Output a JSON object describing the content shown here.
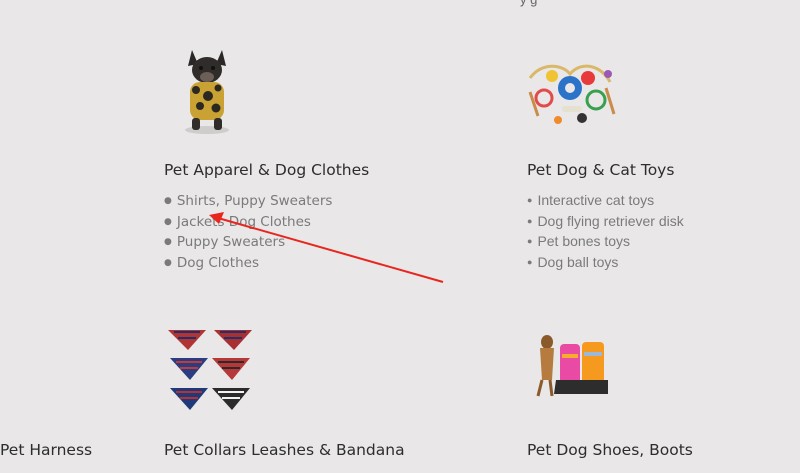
{
  "top_partial_text": "y  g",
  "categories": [
    {
      "title": "Pet Apparel & Dog Clothes",
      "items": [
        "Shirts, Puppy Sweaters",
        "Jackets Dog Clothes",
        "Puppy Sweaters",
        "Dog Clothes"
      ],
      "image_icon": "dog-in-sweater-icon"
    },
    {
      "title": "Pet Dog & Cat Toys",
      "items": [
        "Interactive cat toys",
        "Dog flying retriever disk",
        "Pet bones toys",
        "Dog ball toys"
      ],
      "image_icon": "pet-toys-icon"
    },
    {
      "title": "Pet Harness",
      "items": [],
      "image_icon": ""
    },
    {
      "title": "Pet Collars Leashes & Bandana",
      "items": [],
      "image_icon": "bandanas-icon"
    },
    {
      "title": "Pet Dog Shoes, Boots",
      "items": [],
      "image_icon": "dog-boots-icon"
    }
  ],
  "colors": {
    "background": "#e9e7e7",
    "annotation_arrow": "#e8261f",
    "title_text": "#2d2d2d",
    "item_text": "#7a7a7a"
  }
}
